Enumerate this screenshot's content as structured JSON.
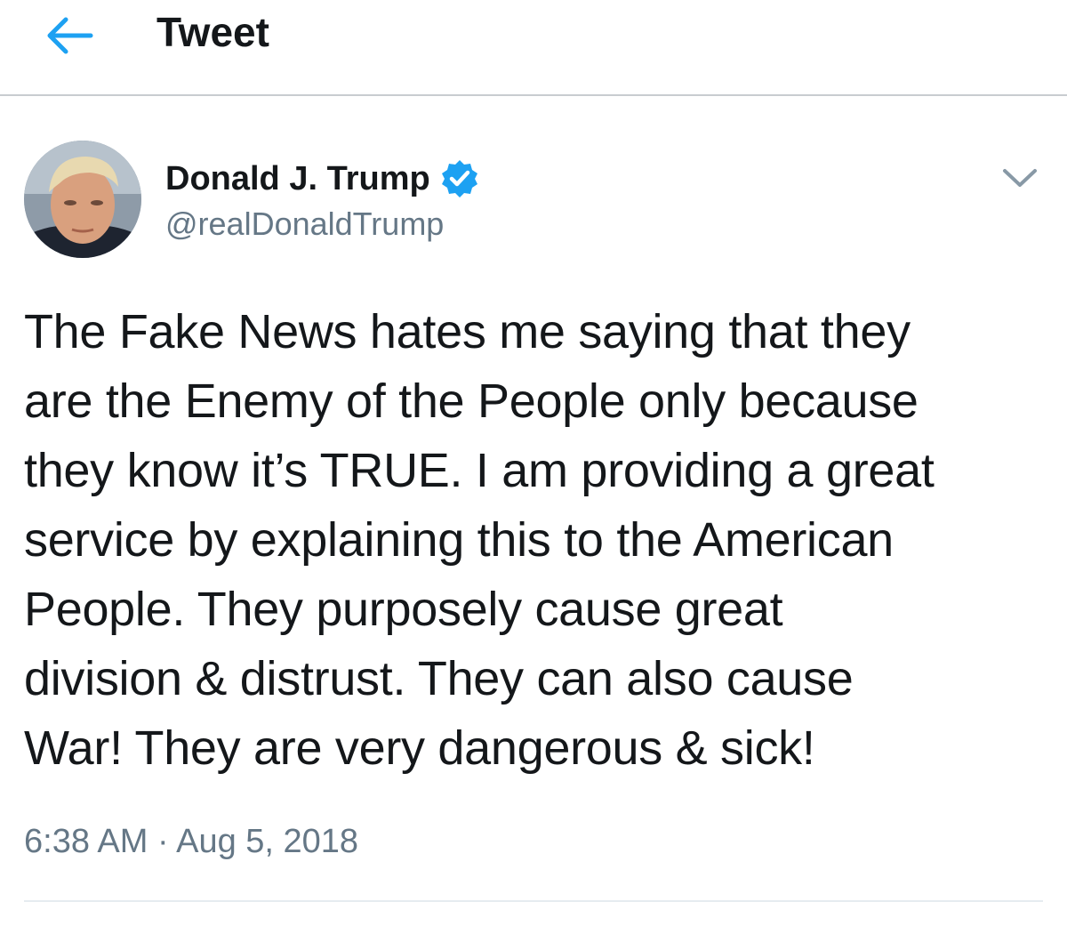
{
  "header": {
    "title": "Tweet",
    "back_icon": "arrow-left-icon",
    "accent_color": "#1da1f2"
  },
  "tweet": {
    "author": {
      "name": "Donald J. Trump",
      "handle": "@realDonaldTrump",
      "verified": true,
      "verified_icon": "verified-badge-icon",
      "avatar_icon": "profile-photo"
    },
    "more_icon": "chevron-down-icon",
    "text_lines": [
      "The Fake News hates me saying that they",
      "are the Enemy of the People only because",
      "they know it’s TRUE. I am providing a great",
      "service by explaining this to the American",
      "People. They purposely cause great",
      "division & distrust. They can also cause",
      "War! They are very dangerous & sick!"
    ],
    "time": "6:38 AM",
    "separator": "·",
    "date": "Aug 5, 2018"
  }
}
